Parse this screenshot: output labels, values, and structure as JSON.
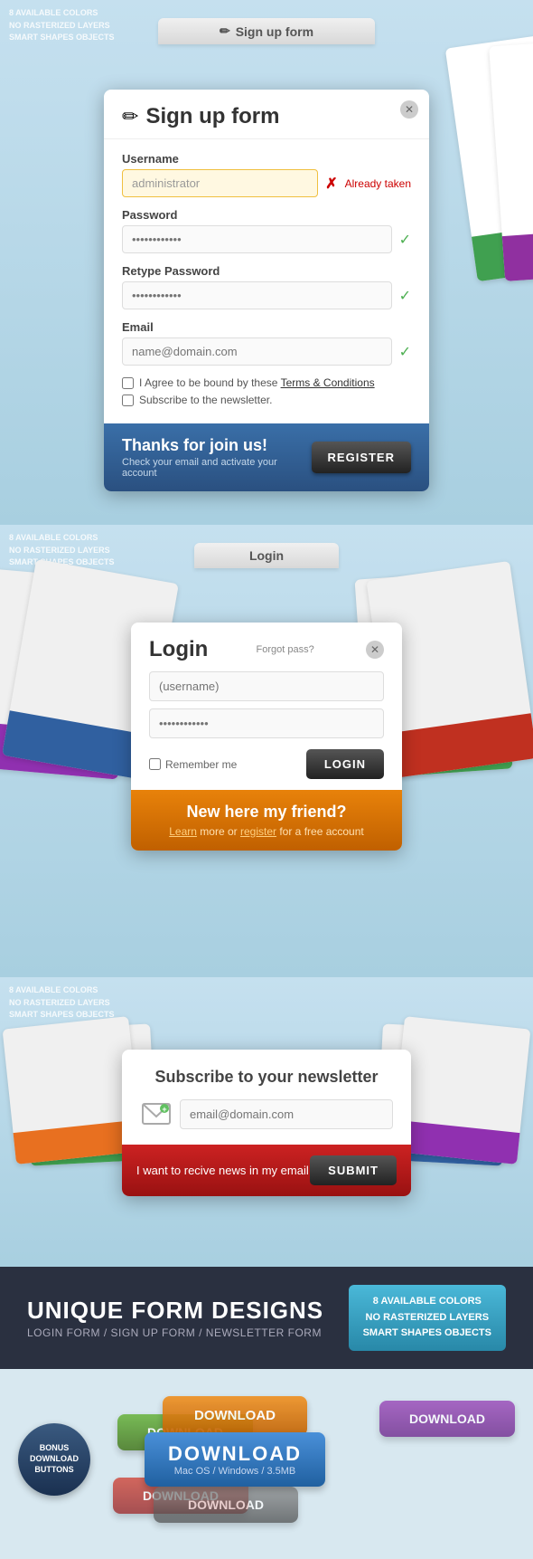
{
  "section1": {
    "badges": [
      "8 AVAILABLE COLORS",
      "NO RASTERIZED LAYERS",
      "SMART SHAPES OBJECTS"
    ],
    "topbar_label": "Sign up form",
    "title": "Sign up form",
    "close_char": "✕",
    "pencil_icon": "✏",
    "fields": [
      {
        "label": "Username",
        "placeholder": "administrator",
        "status": "error",
        "status_text": "Already taken",
        "input_type": "text"
      },
      {
        "label": "Password",
        "placeholder": "••••••••••••",
        "status": "ok",
        "input_type": "password"
      },
      {
        "label": "Retype Password",
        "placeholder": "••••••••••••",
        "status": "ok",
        "input_type": "password"
      },
      {
        "label": "Email",
        "placeholder": "name@domain.com",
        "status": "ok",
        "input_type": "email"
      }
    ],
    "checkbox1_label": "I Agree to be bound by these ",
    "terms_link": "Terms & Conditions",
    "checkbox2_label": "Subscribe to the newsletter.",
    "footer_main": "Thanks for join us!",
    "footer_sub": "Check your email and activate your account",
    "register_btn": "REGISTER"
  },
  "section2": {
    "badges": [
      "8 AVAILABLE COLORS",
      "NO RASTERIZED LAYERS",
      "SMART SHAPES OBJECTS"
    ],
    "topbar_label": "Login",
    "title": "Login",
    "forgot_link": "Forgot pass?",
    "username_placeholder": "(username)",
    "password_placeholder": "••••••••••••",
    "remember_label": "Remember me",
    "login_btn": "LOGIN",
    "footer_main": "New here my friend?",
    "footer_learn": "Learn",
    "footer_text": " more or ",
    "footer_register": "register",
    "footer_end": " for a free account"
  },
  "section3": {
    "badges": [
      "8 AVAILABLE COLORS",
      "NO RASTERIZED LAYERS",
      "SMART SHAPES OBJECTS"
    ],
    "title": "Subscribe to your newsletter",
    "email_placeholder": "email@domain.com",
    "footer_text": "I want to recive news in my email",
    "submit_btn": "SUBMIT"
  },
  "section4": {
    "title": "UNIQUE FORM DESIGNS",
    "subtitle": "LOGIN FORM / SIGN UP FORM / NEWSLETTER FORM",
    "badge_line1": "8 AVAILABLE COLORS",
    "badge_line2": "NO RASTERIZED LAYERS",
    "badge_line3": "SMART SHAPES OBJECTS"
  },
  "section5": {
    "bonus_line1": "BONUS",
    "bonus_line2": "DOWNLOAD",
    "bonus_line3": "BUTTONS",
    "dl_main_label": "DOWNLOAD",
    "dl_main_sub": "Mac OS / Windows / 3.5MB",
    "dl_orange": "DOWNLOAD",
    "dl_green": "DOWNLOAD",
    "dl_purple": "DOWNLOAD",
    "dl_gray": "DOWNLOAD",
    "dl_red": "DOWNLOAD"
  }
}
